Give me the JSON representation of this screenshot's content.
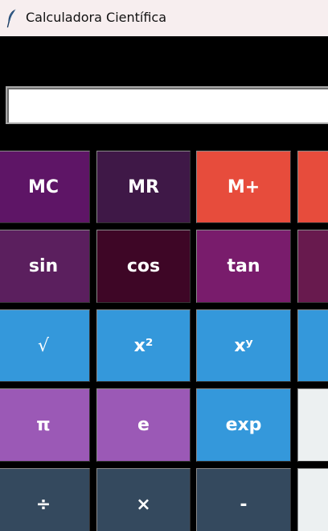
{
  "window": {
    "title": "Calculadora Científica",
    "icon": "feather-icon"
  },
  "display": {
    "value": "",
    "placeholder": ""
  },
  "keypad": {
    "rows": [
      [
        {
          "name": "memory-clear-button",
          "label": "MC",
          "color": "#5e1566"
        },
        {
          "name": "memory-recall-button",
          "label": "MR",
          "color": "#3f1847"
        },
        {
          "name": "memory-add-button",
          "label": "M+",
          "color": "#e74c3c"
        },
        {
          "name": "memory-subtract-button",
          "label": "",
          "color": "#e74c3c"
        }
      ],
      [
        {
          "name": "sin-button",
          "label": "sin",
          "color": "#5b1f5e"
        },
        {
          "name": "cos-button",
          "label": "cos",
          "color": "#3e0626"
        },
        {
          "name": "tan-button",
          "label": "tan",
          "color": "#791c6c"
        },
        {
          "name": "function-button",
          "label": "",
          "color": "#681a4e"
        }
      ],
      [
        {
          "name": "square-root-button",
          "label": "√",
          "color": "#3498db"
        },
        {
          "name": "square-button",
          "label": "x²",
          "color": "#3498db"
        },
        {
          "name": "power-button",
          "label": "xʸ",
          "color": "#3498db"
        },
        {
          "name": "function-button",
          "label": "",
          "color": "#3498db"
        }
      ],
      [
        {
          "name": "pi-button",
          "label": "π",
          "color": "#9b59b6"
        },
        {
          "name": "euler-button",
          "label": "e",
          "color": "#9b59b6"
        },
        {
          "name": "exp-button",
          "label": "exp",
          "color": "#3498db"
        },
        {
          "name": "clear-button",
          "label": "",
          "color": "#ecf0f1"
        }
      ],
      [
        {
          "name": "divide-button",
          "label": "÷",
          "color": "#34495e"
        },
        {
          "name": "multiply-button",
          "label": "×",
          "color": "#34495e"
        },
        {
          "name": "subtract-button",
          "label": "-",
          "color": "#34495e"
        },
        {
          "name": "equals-button",
          "label": "",
          "color": "#ecf0f1"
        }
      ]
    ]
  }
}
